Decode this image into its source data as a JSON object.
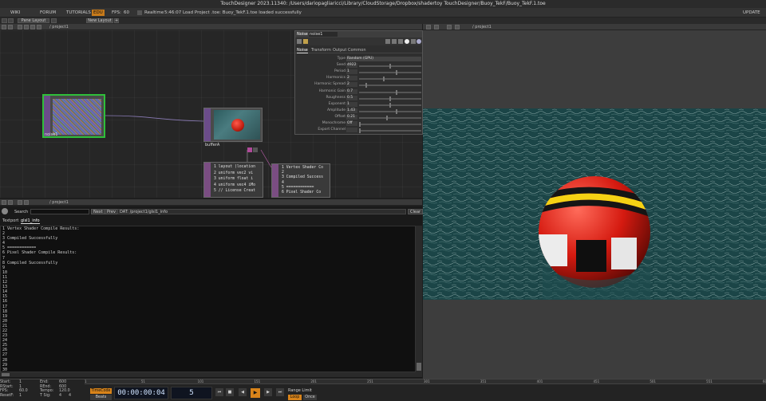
{
  "app": {
    "title": "TouchDesigner 2023.11340: /Users/dariopagliaricci/Library/CloudStorage/Dropbox/shadertoy TouchDesigner/Buoy_TekF/Buoy_TekF.1.toe"
  },
  "menu": {
    "wiki": "WIKI",
    "forum": "FORUM",
    "tutorials": "TUTORIALS",
    "badge": "EDU",
    "fps_label": "FPS:",
    "fps_value": "60",
    "realtime": "Realtime",
    "log": "5:46:07 Load Project .toe: Buoy_TekF.1.toe loaded successfully",
    "update": "UPDATE"
  },
  "tabs": {
    "pane_label": "Pane Layout",
    "new_layout": "New Layout",
    "add": "+"
  },
  "network": {
    "path": "/ project1",
    "nodes": {
      "noise1": "noise1",
      "bufferA": "bufferA"
    },
    "dat1": [
      "1  layout (location",
      "2  uniform vec2 vi",
      "3  uniform float i",
      "4  uniform vec4 iMo",
      "5  // License Creat"
    ],
    "dat2": [
      "1  Vertex Shader Co",
      "2",
      "3  Compiled Success",
      "4",
      "5  ============",
      "6  Pixel Shader Co"
    ]
  },
  "params": {
    "tab": "Noise",
    "name": "noise1",
    "pages": [
      "Noise",
      "Transform",
      "Output",
      "Common"
    ],
    "rows": [
      {
        "label": "Type",
        "value": "Random (GPU)",
        "knob": 0.0
      },
      {
        "label": "Seed",
        "value": "4922",
        "knob": 0.5
      },
      {
        "label": "Period",
        "value": "1",
        "knob": 0.6
      },
      {
        "label": "Harmonics",
        "value": "2",
        "knob": 0.4
      },
      {
        "label": "Harmonic Spread",
        "value": "2",
        "knob": 0.1
      },
      {
        "label": "Harmonic Gain",
        "value": "0.7",
        "knob": 0.6
      },
      {
        "label": "Roughness",
        "value": "0.5",
        "knob": 0.5
      },
      {
        "label": "Exponent",
        "value": "1",
        "knob": 0.5
      },
      {
        "label": "Amplitude",
        "value": "1.43",
        "knob": 0.6
      },
      {
        "label": "Offset",
        "value": "0.21",
        "knob": 0.45
      },
      {
        "label": "Monochrome",
        "value": "Off",
        "knob": 0.0
      },
      {
        "label": "Export Channel",
        "value": "",
        "knob": 0.0
      }
    ]
  },
  "textport": {
    "path": "/ project1",
    "search_label": "Search",
    "next": "Next",
    "prev": "Prev",
    "dat_path": "DAT: /project1/glsl1_info",
    "clear": "Clear",
    "tab1": "Textport",
    "tab2": "glsl1_info",
    "lines": [
      "1  Vertex Shader Compile Results:",
      "2",
      "3  Compiled Successfully",
      "4",
      "5  ============",
      "6  Pixel Shader Compile Results:",
      "7",
      "8  Compiled Successfully",
      "9",
      "10",
      "11",
      "12",
      "13",
      "14",
      "15",
      "16",
      "17",
      "18",
      "19",
      "20",
      "21",
      "22",
      "23",
      "24",
      "25",
      "26",
      "27",
      "28",
      "29",
      "30"
    ]
  },
  "viewer": {
    "path": "/ project1"
  },
  "timeline": {
    "start_label": "Start:",
    "start": "1",
    "rstart_label": "RStart:",
    "rstart": "1",
    "fps_label": "FPS:",
    "fps": "60.0",
    "reset_label": "ResetF:",
    "reset": "1",
    "end_label": "End:",
    "end": "600",
    "rend_label": "REnd:",
    "rend": "600",
    "tempo_label": "Tempo:",
    "tempo": "120.0",
    "tsig_label": "T Sig:",
    "tsig1": "4",
    "tsig2": "4",
    "timecode_btn": "TimeCode",
    "beats_btn": "Beats",
    "timecode": "00:00:00:04",
    "frame": "5",
    "range_limit": "Range Limit",
    "loop": "Loop",
    "once": "Once",
    "ticks": [
      "1",
      "51",
      "101",
      "151",
      "201",
      "251",
      "301",
      "351",
      "401",
      "451",
      "501",
      "551",
      "600"
    ]
  }
}
